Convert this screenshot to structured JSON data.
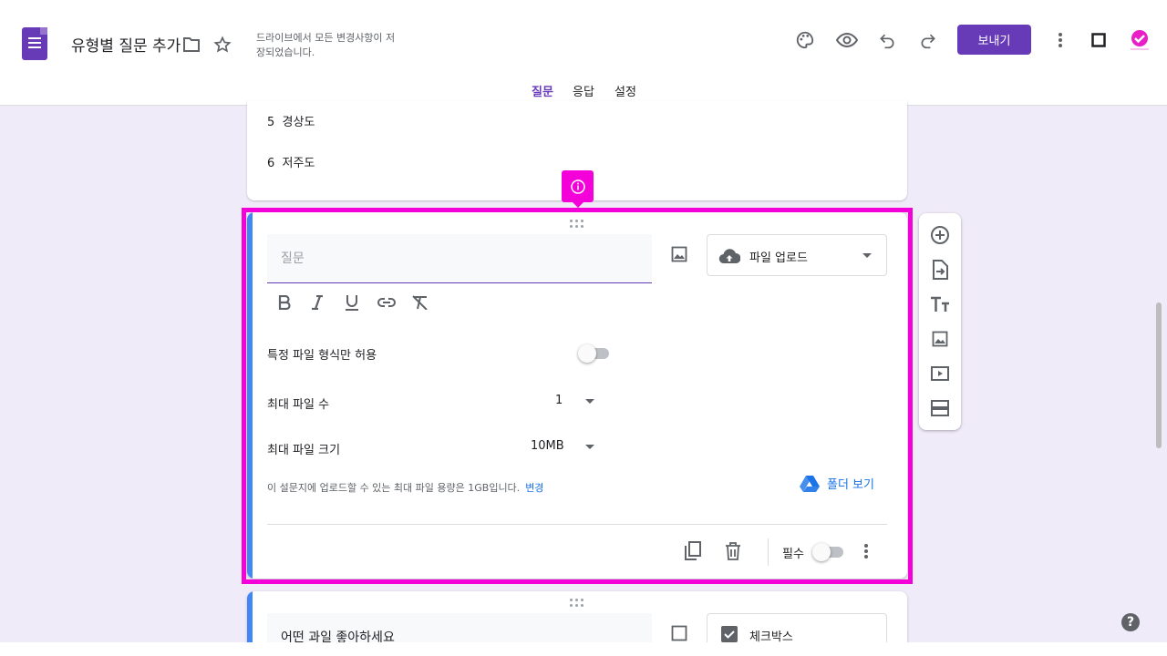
{
  "header": {
    "title": "유형별 질문 추가",
    "save_status": "드라이브에서 모든 변경사항이 저장되었습니다.",
    "send_label": "보내기",
    "icons": [
      "palette-icon",
      "eye-icon",
      "undo-icon",
      "redo-icon",
      "more-vert-icon",
      "square-icon"
    ]
  },
  "tabs": [
    {
      "label": "질문",
      "active": true
    },
    {
      "label": "응답",
      "active": false
    },
    {
      "label": "설정",
      "active": false
    }
  ],
  "prev_card": {
    "options": [
      {
        "num": "5",
        "text": "경상도"
      },
      {
        "num": "6",
        "text": "저주도"
      }
    ]
  },
  "active_card": {
    "question_placeholder": "질문",
    "type_label": "파일 업로드",
    "allow_specific_types_label": "특정 파일 형식만 허용",
    "allow_specific_types_on": false,
    "max_files_label": "최대 파일 수",
    "max_files_value": "1",
    "max_size_label": "최대 파일 크기",
    "max_size_value": "10MB",
    "limit_text": "이 설문지에 업로드할 수 있는 최대 파일 용량은 1GB입니다.",
    "limit_link": "변경",
    "folder_link": "폴더 보기",
    "required_label": "필수",
    "required_on": false
  },
  "next_card": {
    "question_text": "어떤 과일 좋아하세요",
    "type_label": "체크박스"
  },
  "colors": {
    "brand": "#673ab7",
    "highlight": "#f400d8",
    "accent_blue": "#4285f4",
    "background": "#f0ebf8"
  }
}
